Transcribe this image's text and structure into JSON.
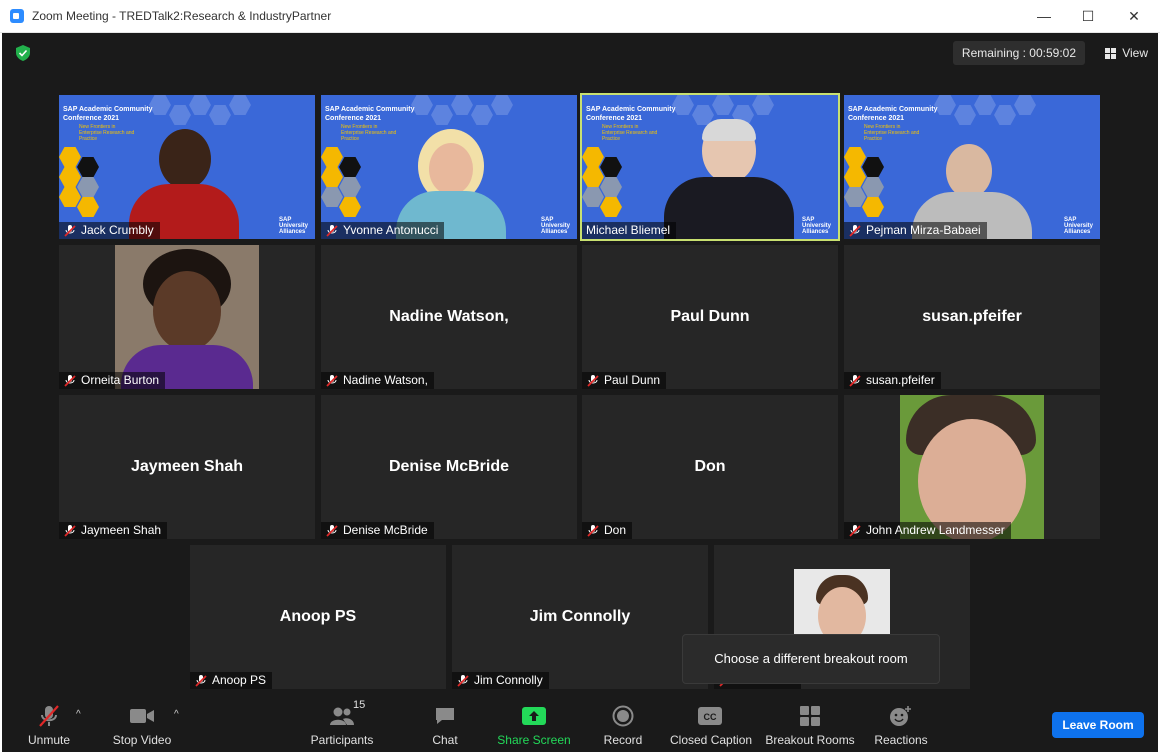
{
  "window": {
    "title": "Zoom Meeting - TREDTalk2:Research & IndustryPartner"
  },
  "header": {
    "remaining": "Remaining : 00:59:02",
    "view_label": "View"
  },
  "background": {
    "conference": "SAP Academic Community Conference 2021",
    "subtitle": "New Frontiers in Enterprise Research and Practice",
    "brand": "SAP University Alliances"
  },
  "participants": [
    {
      "name": "Jack Crumbly",
      "center": ""
    },
    {
      "name": "Yvonne Antonucci",
      "center": ""
    },
    {
      "name": "Michael Bliemel",
      "center": ""
    },
    {
      "name": "Pejman Mirza-Babaei",
      "center": ""
    },
    {
      "name": "Orneita Burton",
      "center": ""
    },
    {
      "name": "Nadine Watson,",
      "center": "Nadine Watson,"
    },
    {
      "name": "Paul Dunn",
      "center": "Paul Dunn"
    },
    {
      "name": "susan.pfeifer",
      "center": "susan.pfeifer"
    },
    {
      "name": "Jaymeen Shah",
      "center": "Jaymeen Shah"
    },
    {
      "name": "Denise McBride",
      "center": "Denise McBride"
    },
    {
      "name": "Don",
      "center": "Don"
    },
    {
      "name": "John Andrew Landmesser",
      "center": ""
    },
    {
      "name": "Anoop PS",
      "center": "Anoop PS"
    },
    {
      "name": "Jim Connolly",
      "center": "Jim Connolly"
    },
    {
      "name": "John Curre",
      "center": ""
    }
  ],
  "tooltip": "Choose a different breakout room",
  "toolbar": {
    "unmute": "Unmute",
    "stop_video": "Stop Video",
    "participants": "Participants",
    "participant_count": "15",
    "chat": "Chat",
    "share_screen": "Share Screen",
    "record": "Record",
    "closed_caption": "Closed Caption",
    "breakout_rooms": "Breakout Rooms",
    "reactions": "Reactions",
    "leave_room": "Leave Room"
  },
  "colors": {
    "accent_blue": "#0e72ed",
    "share_green": "#23d959",
    "speaking_outline": "#c8e070",
    "mic_off_red": "#e02828"
  }
}
